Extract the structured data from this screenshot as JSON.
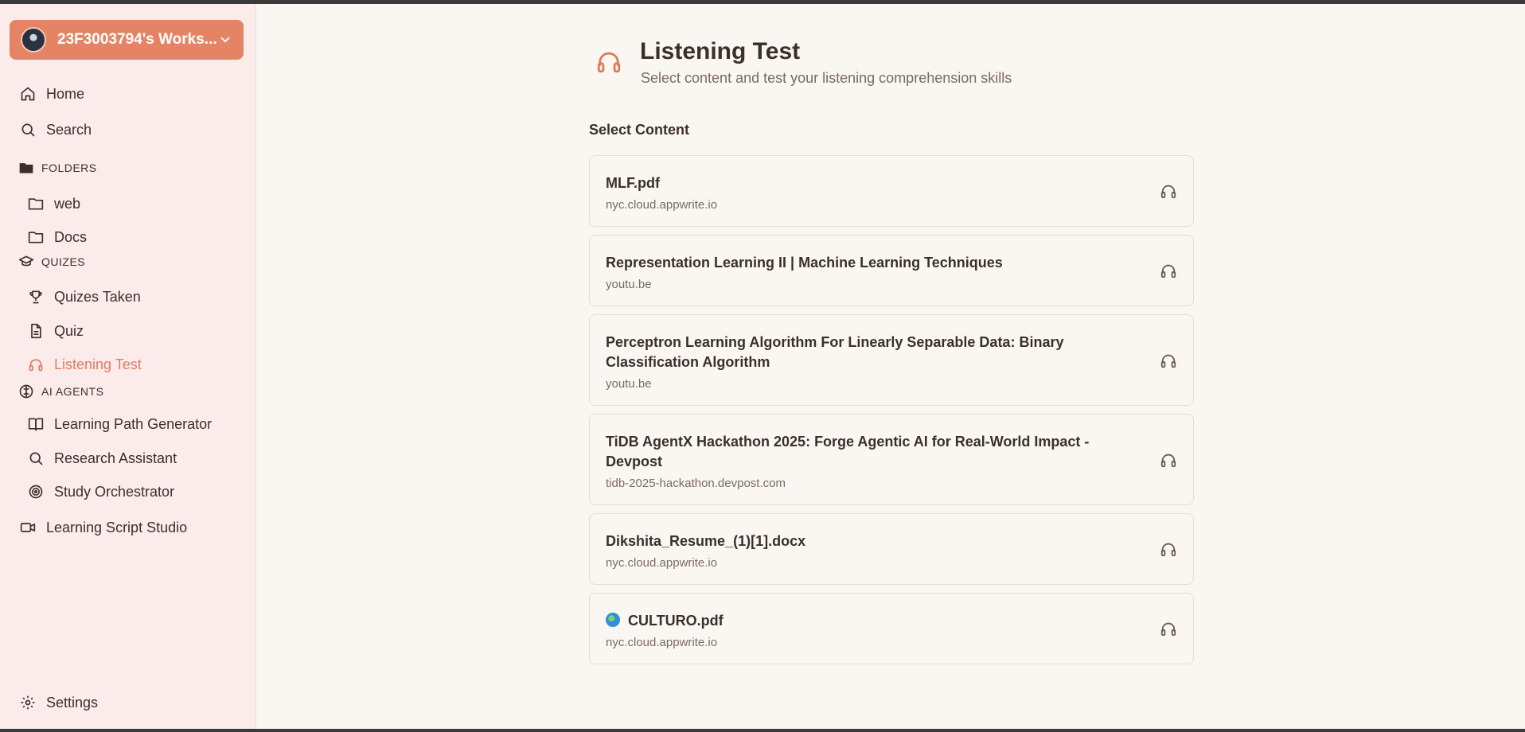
{
  "sidebar": {
    "workspace": "23F3003794's Works...",
    "home": "Home",
    "search": "Search",
    "folders_header": "FOLDERS",
    "folders": [
      "web",
      "Docs"
    ],
    "quizes_header": "QUIZES",
    "quizes_items": [
      "Quizes Taken",
      "Quiz",
      "Listening Test"
    ],
    "agents_header": "AI AGENTS",
    "agents_items": [
      "Learning Path Generator",
      "Research Assistant",
      "Study Orchestrator"
    ],
    "studio": "Learning Script Studio",
    "settings": "Settings"
  },
  "main": {
    "title": "Listening Test",
    "subtitle": "Select content and test your listening comprehension skills",
    "section_title": "Select Content",
    "items": [
      {
        "title": "MLF.pdf",
        "source": "nyc.cloud.appwrite.io"
      },
      {
        "title": "Representation Learning II | Machine Learning Techniques",
        "source": "youtu.be"
      },
      {
        "title": "Perceptron Learning Algorithm For Linearly Separable Data: Binary Classification Algorithm",
        "source": "youtu.be"
      },
      {
        "title": "TiDB AgentX Hackathon 2025: Forge Agentic AI for Real-World Impact - Devpost",
        "source": "tidb-2025-hackathon.devpost.com"
      },
      {
        "title": "Dikshita_Resume_(1)[1].docx",
        "source": "nyc.cloud.appwrite.io"
      },
      {
        "title": "CULTURO.pdf",
        "source": "nyc.cloud.appwrite.io"
      }
    ]
  },
  "colors": {
    "accent": "#e07a5f",
    "workspace_bg": "#e48465",
    "sidebar_bg": "#fbeceb",
    "page_bg": "#faf6f2"
  }
}
